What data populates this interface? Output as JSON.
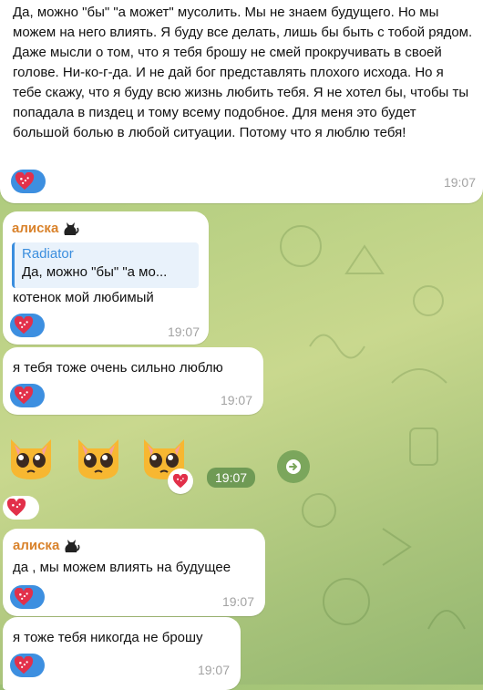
{
  "messages": {
    "m1": {
      "text": "Да, можно \"бы\" \"а может\" мусолить. Мы не знаем будущего. Но мы можем на него влиять. Я буду все делать, лишь бы быть с тобой рядом. Даже мысли о том, что я тебя брошу не смей прокручивать в своей голове. Ни-ко-г-да. И не дай бог представлять плохого исхода.  Но я тебе скажу, что я буду всю жизнь любить тебя. Я не хотел бы, чтобы ты попадала в пиздец и тому всему подобное. Для меня это будет большой болью в любой ситуации. Потому что я люблю тебя!",
      "time": "19:07"
    },
    "m2": {
      "sender": "алиска",
      "reply_name": "Radiator",
      "reply_text": "Да, можно \"бы\" \"а мо...",
      "text": "котенок мой любимый",
      "time": "19:07"
    },
    "m3": {
      "text": "я тебя тоже очень сильно люблю",
      "time": "19:07"
    },
    "m4": {
      "time": "19:07"
    },
    "m5": {
      "sender": "алиска",
      "text": "да , мы можем влиять на будущее",
      "time": "19:07"
    },
    "m6": {
      "text": "я тоже тебя никогда не брошу",
      "time": "19:07"
    }
  },
  "colors": {
    "sender": "#d9822b",
    "reaction_bg": "#3d8fe0",
    "reply_accent": "#3b8ede"
  }
}
